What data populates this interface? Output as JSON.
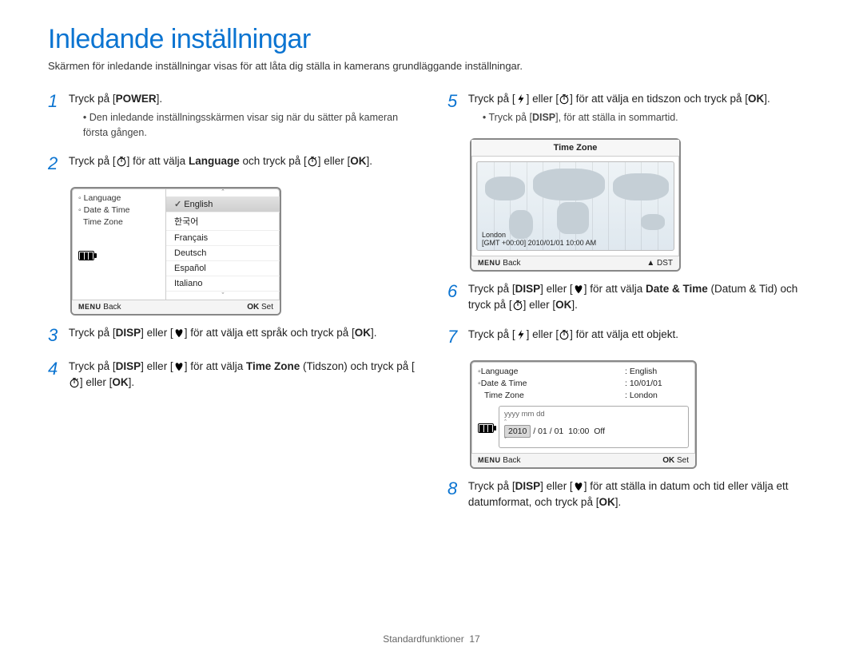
{
  "title": "Inledande inställningar",
  "subtitle": "Skärmen för inledande inställningar visas för att låta dig ställa in kamerans grundläggande inställningar.",
  "icons": {
    "power": "POWER",
    "disp": "DISP",
    "ok": "OK",
    "menu": "MENU",
    "flash": "flash-icon",
    "timer": "timer-icon",
    "macro": "macro-icon",
    "up": "▲"
  },
  "steps_left": [
    {
      "num": "1",
      "text_pre": "Tryck på [",
      "btn": "POWER",
      "text_post": "].",
      "bullet": "Den inledande inställningsskärmen visar sig när du sätter på kameran första gången."
    },
    {
      "num": "2",
      "parts": [
        "Tryck på [",
        {
          "icon": "timer"
        },
        "] för att välja ",
        {
          "bold": "Language"
        },
        " och tryck på [",
        {
          "icon": "timer"
        },
        "] eller [",
        {
          "bold": "OK"
        },
        "]."
      ]
    },
    {
      "num": "3",
      "parts": [
        "Tryck på [",
        {
          "bold": "DISP"
        },
        "] eller [",
        {
          "icon": "macro"
        },
        "] för att välja ett språk och tryck på [",
        {
          "bold": "OK"
        },
        "]."
      ]
    },
    {
      "num": "4",
      "parts": [
        "Tryck på [",
        {
          "bold": "DISP"
        },
        "] eller [",
        {
          "icon": "macro"
        },
        "] för att välja ",
        {
          "bold": "Time Zone"
        },
        " (Tidszon) och tryck på [",
        {
          "icon": "timer"
        },
        "] eller [",
        {
          "bold": "OK"
        },
        "]."
      ]
    }
  ],
  "steps_right": [
    {
      "num": "5",
      "parts": [
        "Tryck på [",
        {
          "icon": "flash"
        },
        "] eller [",
        {
          "icon": "timer"
        },
        "] för att välja en tidszon och tryck på [",
        {
          "bold": "OK"
        },
        "]."
      ],
      "bullet_parts": [
        "Tryck på [",
        {
          "bold": "DISP"
        },
        "], för att ställa in sommartid."
      ]
    },
    {
      "num": "6",
      "parts": [
        "Tryck på [",
        {
          "bold": "DISP"
        },
        "] eller [",
        {
          "icon": "macro"
        },
        "] för att välja ",
        {
          "bold": "Date & Time"
        },
        " (Datum & Tid) och tryck på [",
        {
          "icon": "timer"
        },
        "] eller [",
        {
          "bold": "OK"
        },
        "]."
      ]
    },
    {
      "num": "7",
      "parts": [
        "Tryck på [",
        {
          "icon": "flash"
        },
        "] eller [",
        {
          "icon": "timer"
        },
        "] för att välja ett objekt."
      ]
    },
    {
      "num": "8",
      "parts": [
        "Tryck på [",
        {
          "bold": "DISP"
        },
        "] eller [",
        {
          "icon": "macro"
        },
        "] för att ställa in datum och tid eller välja ett datumformat, och tryck på [",
        {
          "bold": "OK"
        },
        "]."
      ]
    }
  ],
  "lang_shot": {
    "left_items": [
      "Language",
      "Date & Time",
      "Time Zone"
    ],
    "options": [
      "English",
      "한국어",
      "Français",
      "Deutsch",
      "Español",
      "Italiano"
    ],
    "selected": "English",
    "footer_left_label": "MENU",
    "footer_left_text": "Back",
    "footer_right_label": "OK",
    "footer_right_text": "Set"
  },
  "tz_shot": {
    "title": "Time Zone",
    "city": "London",
    "gmt": "[GMT +00:00] 2010/01/01 10:00 AM",
    "footer_left_label": "MENU",
    "footer_left_text": "Back",
    "footer_right_arrow": "▲",
    "footer_right_text": "DST"
  },
  "dt_shot": {
    "rows": [
      {
        "key": "Language",
        "val": ": English"
      },
      {
        "key": "Date & Time",
        "val": ": 10/01/01"
      },
      {
        "key": "Time Zone",
        "val": ": London"
      }
    ],
    "format_hint": "yyyy  mm  dd",
    "edit_line": {
      "year": "2010",
      "sep1": " / ",
      "month": "01",
      "sep2": " / ",
      "day": "01",
      "time": "10:00",
      "dst": "Off"
    },
    "footer_left_label": "MENU",
    "footer_left_text": "Back",
    "footer_right_label": "OK",
    "footer_right_text": "Set"
  },
  "footer": {
    "section": "Standardfunktioner",
    "page": "17"
  }
}
